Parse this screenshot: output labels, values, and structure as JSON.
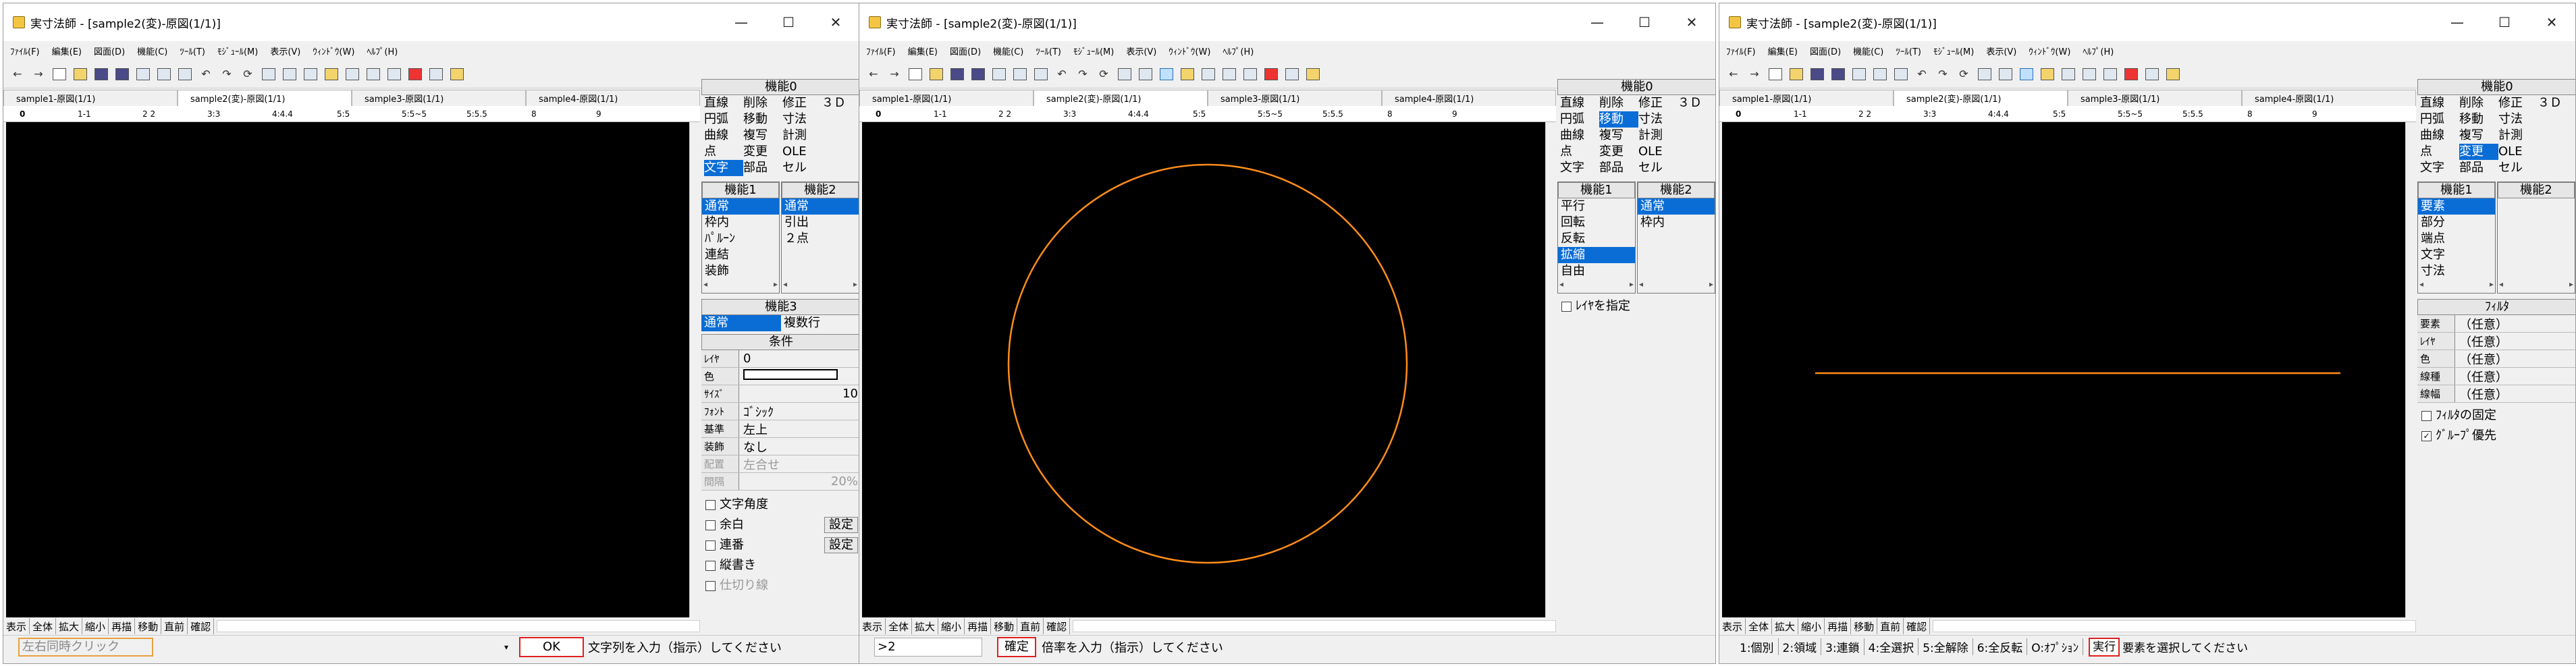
{
  "title": "実寸法師 - [sample2(変)-原図(1/1)]",
  "menu": [
    "ﾌｧｲﾙ(F)",
    "編集(E)",
    "図面(D)",
    "機能(C)",
    "ﾂｰﾙ(T)",
    "ﾓｼﾞｭｰﾙ(M)",
    "表示(V)",
    "ｳｨﾝﾄﾞｳ(W)",
    "ﾍﾙﾌﾟ(H)"
  ],
  "tabs": [
    "sample1-原図(1/1)",
    "sample2(変)-原図(1/1)",
    "sample3-原図(1/1)",
    "sample4-原図(1/1)"
  ],
  "layers": [
    "0",
    "1-1",
    "2 2",
    "3:3",
    "4:4.4",
    "5:5",
    "5:5~5",
    "5:5.5",
    "8",
    "9"
  ],
  "window_buttons": [
    "—",
    "☐",
    "✕"
  ],
  "nav_left": "←",
  "nav_right": "→",
  "bottom_buttons": [
    "表示",
    "全体",
    "拡大",
    "縮小",
    "再描",
    "移動",
    "直前",
    "確認"
  ],
  "panel_kino0": {
    "title": "機能0",
    "items": [
      "直線",
      "削除",
      "修正",
      "３Ｄ",
      "円弧",
      "移動",
      "寸法",
      "",
      "曲線",
      "複写",
      "計測",
      "",
      "点",
      "変更",
      "OLE",
      "",
      "文字",
      "部品",
      "セル",
      ""
    ]
  },
  "w1": {
    "kino1_title": "機能1",
    "kino1": [
      "通常",
      "枠内",
      "ﾊﾟﾙｰﾝ",
      "連結",
      "装飾"
    ],
    "kino2_title": "機能2",
    "kino2": [
      "通常",
      "引出",
      "２点"
    ],
    "kino3_title": "機能3",
    "kino3": [
      "通常",
      "複数行"
    ],
    "cond_title": "条件",
    "conditions": [
      {
        "k": "ﾚｲﾔ",
        "v": "0"
      },
      {
        "k": "色",
        "v": ""
      },
      {
        "k": "ｻｲｽﾞ",
        "v": "10"
      },
      {
        "k": "ﾌｫﾝﾄ",
        "v": "ｺﾞｼｯｸ"
      },
      {
        "k": "基準",
        "v": "左上"
      },
      {
        "k": "装飾",
        "v": "なし"
      },
      {
        "k": "配置",
        "v": "左合せ"
      },
      {
        "k": "間隔",
        "v": "20%"
      }
    ],
    "checks": [
      "文字角度",
      "余白",
      "連番",
      "縦書き",
      "仕切り線"
    ],
    "settei": [
      "設定",
      "設定"
    ],
    "input_value": "左右同時クリック",
    "ok": "OK",
    "message": "文字列を入力（指示）してください"
  },
  "w2": {
    "kino1_title": "機能1",
    "kino1": [
      "平行",
      "回転",
      "反転",
      "拡縮",
      "自由"
    ],
    "kino2_title": "機能2",
    "kino2": [
      "通常",
      "枠内"
    ],
    "check": "ﾚｲﾔを指定",
    "input_value": "2",
    "confirm": "確定",
    "message": "倍率を入力（指示）してください",
    "circle_color": "#ff8c1a"
  },
  "w3": {
    "kino1_title": "機能1",
    "kino1": [
      "要素",
      "部分",
      "端点",
      "文字",
      "寸法"
    ],
    "kino2_title": "機能2",
    "filter_title": "ﾌｨﾙﾀ",
    "filters": [
      {
        "k": "要素",
        "v": "（任意）"
      },
      {
        "k": "ﾚｲﾔ",
        "v": "（任意）"
      },
      {
        "k": "色",
        "v": "（任意）"
      },
      {
        "k": "線種",
        "v": "（任意）"
      },
      {
        "k": "線幅",
        "v": "（任意）"
      }
    ],
    "checks": [
      "ﾌｨﾙﾀの固定",
      "ｸﾞﾙｰﾌﾟ優先"
    ],
    "status_buttons": [
      "1:個別",
      "2:領域",
      "3:連鎖",
      "4:全選択",
      "5:全解除",
      "6:全反転",
      "O:ｵﾌﾟｼｮﾝ"
    ],
    "execute": "実行",
    "message": "要素を選択してください",
    "line_color": "#ff8c1a"
  },
  "colors": {
    "selection": "#0a6dd6",
    "canvas": "#000000",
    "highlight_border": "#e02020"
  }
}
